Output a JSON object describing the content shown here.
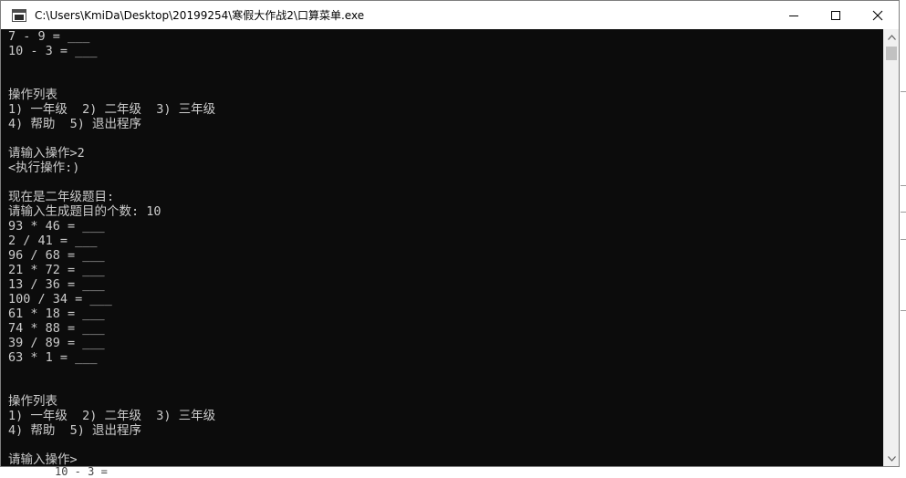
{
  "window": {
    "title": "C:\\Users\\KmiDa\\Desktop\\20199254\\寒假大作战2\\口算菜单.exe"
  },
  "icons": {
    "app": "console-window-icon",
    "minimize": "minimize-icon",
    "maximize": "maximize-icon",
    "close": "close-icon",
    "scroll_up": "chevron-up-icon",
    "scroll_down": "chevron-down-icon"
  },
  "console": {
    "lines": [
      "7 - 9 = ___",
      "10 - 3 = ___",
      "",
      "",
      "操作列表",
      "1) 一年级  2) 二年级  3) 三年级",
      "4) 帮助  5) 退出程序",
      "",
      "请输入操作>2",
      "<执行操作:)",
      "",
      "现在是二年级题目:",
      "请输入生成题目的个数: 10",
      "93 * 46 = ___",
      "2 / 41 = ___",
      "96 / 68 = ___",
      "21 * 72 = ___",
      "13 / 36 = ___",
      "100 / 34 = ___",
      "61 * 18 = ___",
      "74 * 88 = ___",
      "39 / 89 = ___",
      "63 * 1 = ___",
      "",
      "",
      "操作列表",
      "1) 一年级  2) 二年级  3) 三年级",
      "4) 帮助  5) 退出程序",
      "",
      "请输入操作>"
    ]
  },
  "background_window_text": "10 - 3 =",
  "colors": {
    "console_bg": "#0c0c0c",
    "console_fg": "#cccccc",
    "titlebar_bg": "#ffffff"
  }
}
